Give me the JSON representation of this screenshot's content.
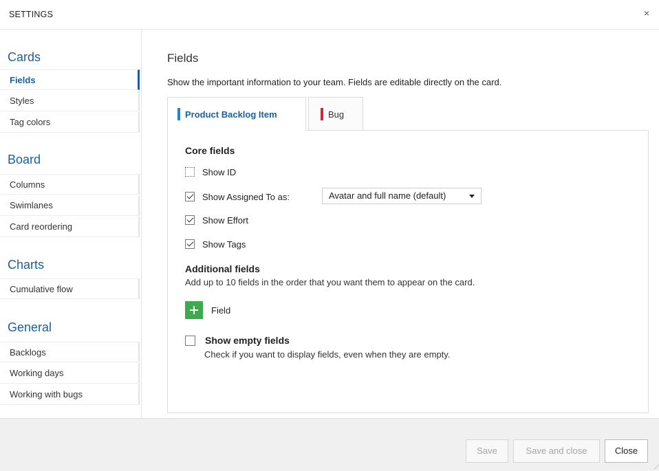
{
  "dialog": {
    "title": "SETTINGS",
    "close_glyph": "×"
  },
  "sidebar": {
    "sections": [
      {
        "title": "Cards",
        "items": [
          "Fields",
          "Styles",
          "Tag colors"
        ]
      },
      {
        "title": "Board",
        "items": [
          "Columns",
          "Swimlanes",
          "Card reordering"
        ]
      },
      {
        "title": "Charts",
        "items": [
          "Cumulative flow"
        ]
      },
      {
        "title": "General",
        "items": [
          "Backlogs",
          "Working days",
          "Working with bugs"
        ]
      }
    ],
    "active_item": "Fields"
  },
  "main": {
    "title": "Fields",
    "description": "Show the important information to your team. Fields are editable directly on the card.",
    "tabs": [
      {
        "label": "Product Backlog Item",
        "color": "#1e88c9",
        "active": true
      },
      {
        "label": "Bug",
        "color": "#cc293d",
        "active": false
      }
    ],
    "core": {
      "heading": "Core fields",
      "show_id": {
        "label": "Show ID",
        "checked": false
      },
      "show_assigned": {
        "label": "Show Assigned To as:",
        "checked": true,
        "dropdown_value": "Avatar and full name (default)"
      },
      "show_effort": {
        "label": "Show Effort",
        "checked": true
      },
      "show_tags": {
        "label": "Show Tags",
        "checked": true
      }
    },
    "additional": {
      "heading": "Additional fields",
      "help": "Add up to 10 fields in the order that you want them to appear on the card.",
      "add_label": "Field"
    },
    "empty_fields": {
      "label": "Show empty fields",
      "help": "Check if you want to display fields, even when they are empty.",
      "checked": false
    }
  },
  "footer": {
    "save": "Save",
    "save_close": "Save and close",
    "close": "Close"
  },
  "colors": {
    "accent": "#1a5f9c",
    "add_green": "#3daa4f"
  }
}
